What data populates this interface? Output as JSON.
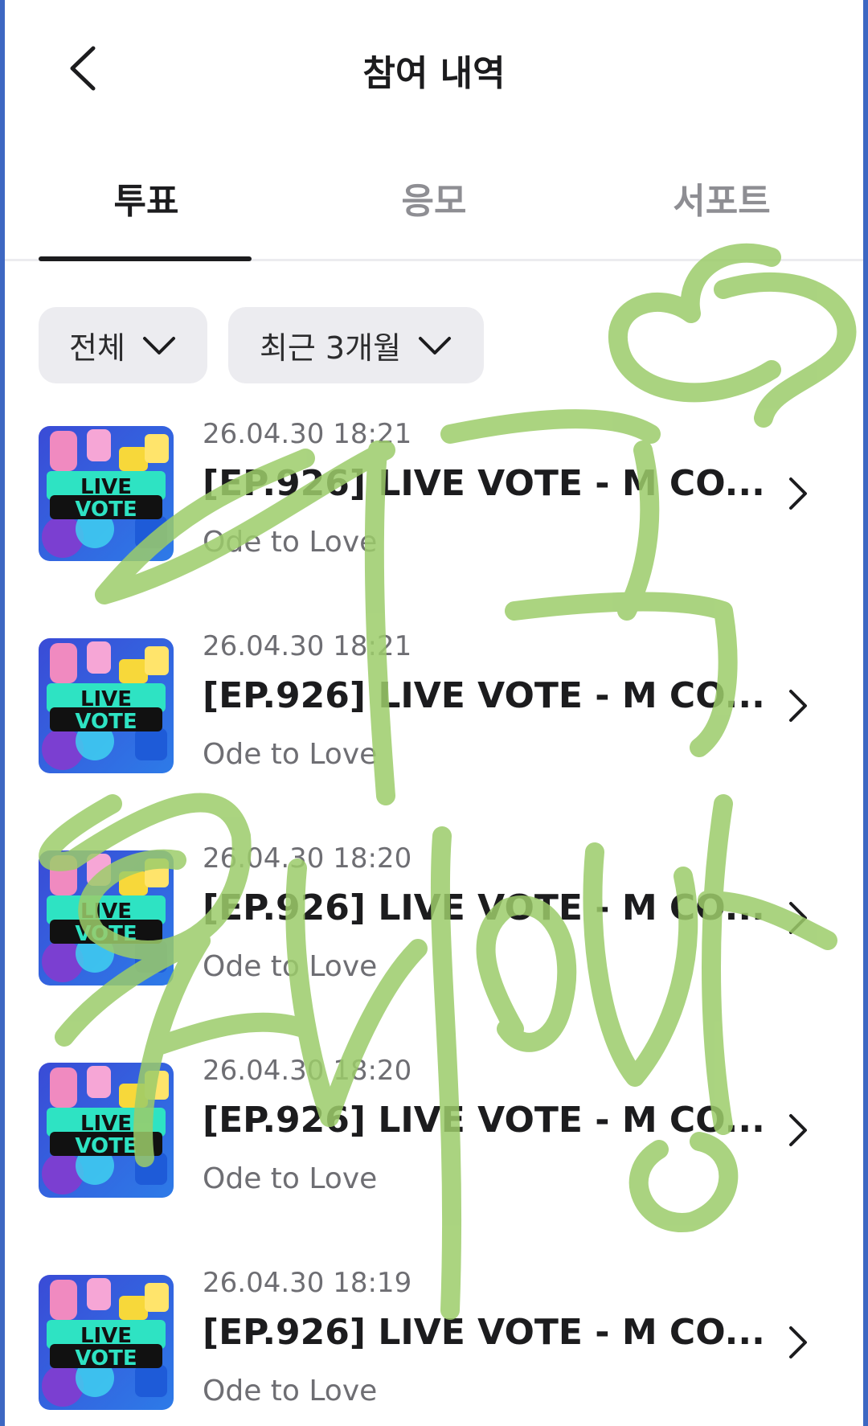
{
  "header": {
    "title": "참여 내역",
    "back_icon": "chevron-left-icon"
  },
  "tabs": [
    {
      "label": "투표",
      "active": true
    },
    {
      "label": "응모",
      "active": false
    },
    {
      "label": "서포트",
      "active": false
    }
  ],
  "filters": [
    {
      "label": "전체",
      "icon": "chevron-down-icon"
    },
    {
      "label": "최근 3개월",
      "icon": "chevron-down-icon"
    }
  ],
  "thumbnail_text": {
    "line1": "LIVE",
    "line2": "VOTE"
  },
  "items": [
    {
      "date": "26.04.30 18:21",
      "title": "[EP.926] LIVE VOTE - M CO...",
      "subtitle": "Ode to Love"
    },
    {
      "date": "26.04.30 18:21",
      "title": "[EP.926] LIVE VOTE - M CO...",
      "subtitle": "Ode to Love"
    },
    {
      "date": "26.04.30 18:20",
      "title": "[EP.926] LIVE VOTE - M CO...",
      "subtitle": "Ode to Love"
    },
    {
      "date": "26.04.30 18:20",
      "title": "[EP.926] LIVE VOTE - M CO...",
      "subtitle": "Ode to Love"
    },
    {
      "date": "26.04.30 18:19",
      "title": "[EP.926] LIVE VOTE - M CO...",
      "subtitle": "Ode to Love"
    }
  ],
  "colors": {
    "accent": "#1c1c1e",
    "overlay_stroke": "#9ccc6a",
    "frame": "#3d67c2"
  }
}
